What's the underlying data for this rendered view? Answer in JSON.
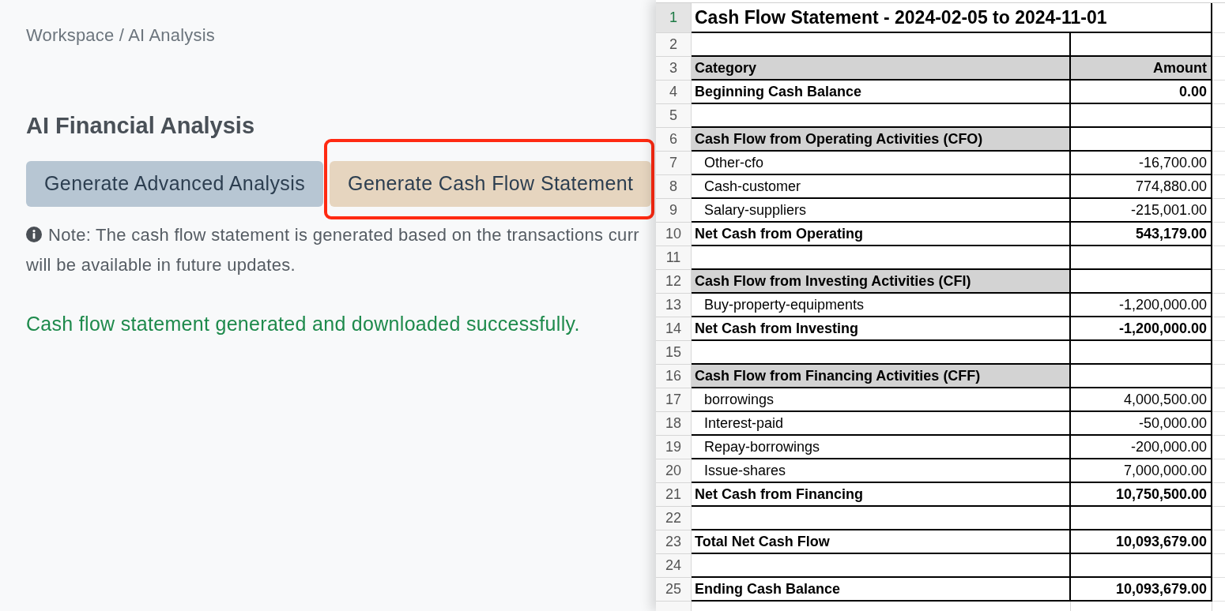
{
  "breadcrumb": "Workspace / AI Analysis",
  "heading": "AI Financial Analysis",
  "buttons": [
    {
      "label": "Generate Advanced Analysis",
      "kind": "secondary",
      "highlighted": false
    },
    {
      "label": "Generate Cash Flow Statement",
      "kind": "warning",
      "highlighted": true
    }
  ],
  "note": {
    "lines": [
      "Note: The cash flow statement is generated based on the transactions curr",
      "will be available in future updates."
    ]
  },
  "success_message": "Cash flow statement generated and downloaded successfully.",
  "spreadsheet": {
    "rows": [
      {
        "number": "1",
        "kind": "title",
        "selected": true,
        "cells": [
          "Cash Flow Statement - 2024-02-05 to 2024-11-01"
        ]
      },
      {
        "number": "2",
        "kind": "blank",
        "selected": false
      },
      {
        "number": "3",
        "kind": "header",
        "selected": false,
        "cells": [
          "Category",
          "Amount"
        ]
      },
      {
        "number": "4",
        "kind": "total",
        "selected": false,
        "cells": [
          "Beginning Cash Balance",
          "0.00"
        ]
      },
      {
        "number": "5",
        "kind": "blank",
        "selected": false
      },
      {
        "number": "6",
        "kind": "section",
        "selected": false,
        "cells": [
          "Cash Flow from Operating Activities (CFO)"
        ]
      },
      {
        "number": "7",
        "kind": "item",
        "selected": false,
        "cells": [
          "Other-cfo",
          "-16,700.00"
        ]
      },
      {
        "number": "8",
        "kind": "item",
        "selected": false,
        "cells": [
          "Cash-customer",
          "774,880.00"
        ]
      },
      {
        "number": "9",
        "kind": "item",
        "selected": false,
        "cells": [
          "Salary-suppliers",
          "-215,001.00"
        ]
      },
      {
        "number": "10",
        "kind": "total",
        "selected": false,
        "cells": [
          "Net Cash from Operating",
          "543,179.00"
        ]
      },
      {
        "number": "11",
        "kind": "blank",
        "selected": false
      },
      {
        "number": "12",
        "kind": "section",
        "selected": false,
        "cells": [
          "Cash Flow from Investing Activities (CFI)"
        ]
      },
      {
        "number": "13",
        "kind": "item",
        "selected": false,
        "cells": [
          "Buy-property-equipments",
          "-1,200,000.00"
        ]
      },
      {
        "number": "14",
        "kind": "total",
        "selected": false,
        "cells": [
          "Net Cash from Investing",
          "-1,200,000.00"
        ]
      },
      {
        "number": "15",
        "kind": "blank",
        "selected": false
      },
      {
        "number": "16",
        "kind": "section",
        "selected": false,
        "cells": [
          "Cash Flow from Financing Activities (CFF)"
        ]
      },
      {
        "number": "17",
        "kind": "item",
        "selected": false,
        "cells": [
          "borrowings",
          "4,000,500.00"
        ]
      },
      {
        "number": "18",
        "kind": "item",
        "selected": false,
        "cells": [
          "Interest-paid",
          "-50,000.00"
        ]
      },
      {
        "number": "19",
        "kind": "item",
        "selected": false,
        "cells": [
          "Repay-borrowings",
          "-200,000.00"
        ]
      },
      {
        "number": "20",
        "kind": "item",
        "selected": false,
        "cells": [
          "Issue-shares",
          "7,000,000.00"
        ]
      },
      {
        "number": "21",
        "kind": "total",
        "selected": false,
        "cells": [
          "Net Cash from Financing",
          "10,750,500.00"
        ]
      },
      {
        "number": "22",
        "kind": "blank",
        "selected": false
      },
      {
        "number": "23",
        "kind": "total",
        "selected": false,
        "cells": [
          "Total Net Cash Flow",
          "10,093,679.00"
        ]
      },
      {
        "number": "24",
        "kind": "blank",
        "selected": false
      },
      {
        "number": "25",
        "kind": "total",
        "selected": false,
        "cells": [
          "Ending Cash Balance",
          "10,093,679.00"
        ]
      }
    ]
  }
}
